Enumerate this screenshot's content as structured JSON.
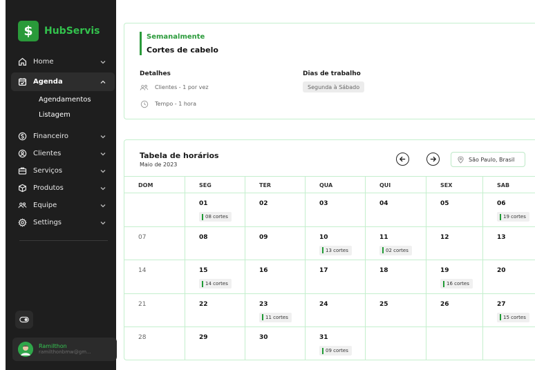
{
  "app": {
    "name": "HubServis",
    "logo_glyph": "$"
  },
  "sidebar": {
    "items": [
      {
        "key": "home",
        "label": "Home",
        "icon": "home-icon"
      },
      {
        "key": "agenda",
        "label": "Agenda",
        "icon": "calendar-check-icon",
        "expanded": true
      },
      {
        "key": "financeiro",
        "label": "Financeiro",
        "icon": "dollar-circle-icon"
      },
      {
        "key": "clientes",
        "label": "Clientes",
        "icon": "user-circle-icon"
      },
      {
        "key": "servicos",
        "label": "Serviços",
        "icon": "briefcase-icon"
      },
      {
        "key": "produtos",
        "label": "Produtos",
        "icon": "box-icon"
      },
      {
        "key": "equipe",
        "label": "Equipe",
        "icon": "users-icon"
      },
      {
        "key": "settings",
        "label": "Settings",
        "icon": "gear-icon"
      }
    ],
    "subitems": [
      "Agendamentos",
      "Listagem"
    ]
  },
  "user": {
    "name": "Ramilthon",
    "email": "ramilthonbmw@gm..."
  },
  "schedule": {
    "label": "Semanalmente",
    "title": "Cortes de cabelo",
    "details_title": "Detalhes",
    "clients": "Clientes - 1 por vez",
    "time": "Tempo - 1 hora",
    "days_title": "Dias de trabalho",
    "days_value": "Segunda à Sábado"
  },
  "timetable": {
    "title": "Tabela de horários",
    "month": "Maio de 2023",
    "location": "São Paulo, Brasil",
    "weekdays": [
      "DOM",
      "SEG",
      "TER",
      "QUA",
      "QUI",
      "SEX",
      "SAB"
    ],
    "weeks": [
      [
        {
          "day": ""
        },
        {
          "day": "01",
          "badge": "08 cortes"
        },
        {
          "day": "02"
        },
        {
          "day": "03"
        },
        {
          "day": "04"
        },
        {
          "day": "05"
        },
        {
          "day": "06",
          "badge": "19 cortes"
        }
      ],
      [
        {
          "day": "07",
          "dim": true
        },
        {
          "day": "08"
        },
        {
          "day": "09"
        },
        {
          "day": "10",
          "badge": "13 cortes"
        },
        {
          "day": "11",
          "badge": "02 cortes"
        },
        {
          "day": "12"
        },
        {
          "day": "13"
        }
      ],
      [
        {
          "day": "14",
          "dim": true
        },
        {
          "day": "15",
          "badge": "14 cortes"
        },
        {
          "day": "16"
        },
        {
          "day": "17"
        },
        {
          "day": "18"
        },
        {
          "day": "19",
          "badge": "16 cortes"
        },
        {
          "day": "20"
        }
      ],
      [
        {
          "day": "21",
          "dim": true
        },
        {
          "day": "22"
        },
        {
          "day": "23",
          "badge": "11 cortes"
        },
        {
          "day": "24"
        },
        {
          "day": "25"
        },
        {
          "day": "26"
        },
        {
          "day": "27",
          "badge": "15 cortes"
        }
      ],
      [
        {
          "day": "28",
          "dim": true
        },
        {
          "day": "29"
        },
        {
          "day": "30"
        },
        {
          "day": "31",
          "badge": "09 cortes"
        },
        {
          "day": ""
        },
        {
          "day": ""
        },
        {
          "day": ""
        }
      ]
    ]
  },
  "colors": {
    "accent": "#2a9a3a",
    "border": "#c4efcd",
    "sidebar": "#1e1e1e"
  }
}
